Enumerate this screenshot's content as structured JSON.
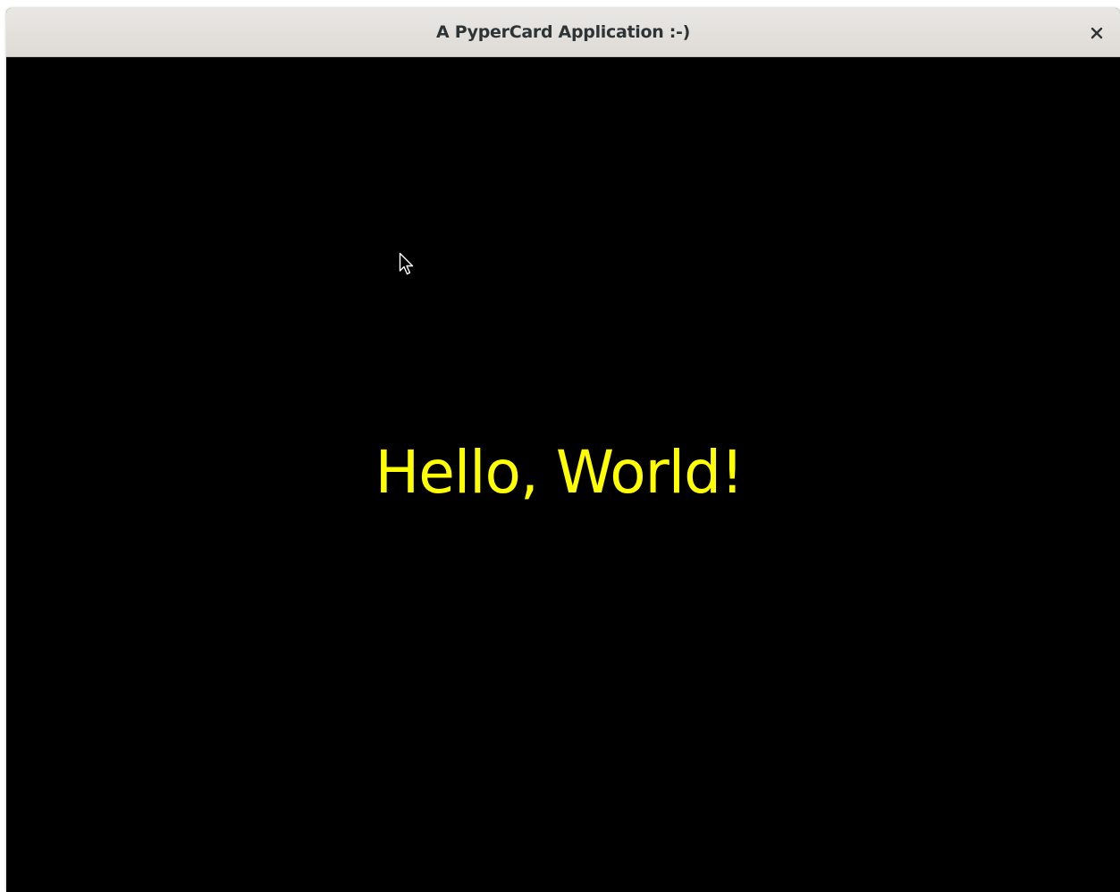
{
  "window": {
    "title": "A PyperCard Application :-)",
    "close_icon": "close-icon"
  },
  "card": {
    "background_color": "#000000",
    "text": "Hello, World!",
    "text_color": "#ffff00"
  },
  "pointer": {
    "icon": "mouse-pointer-icon"
  }
}
